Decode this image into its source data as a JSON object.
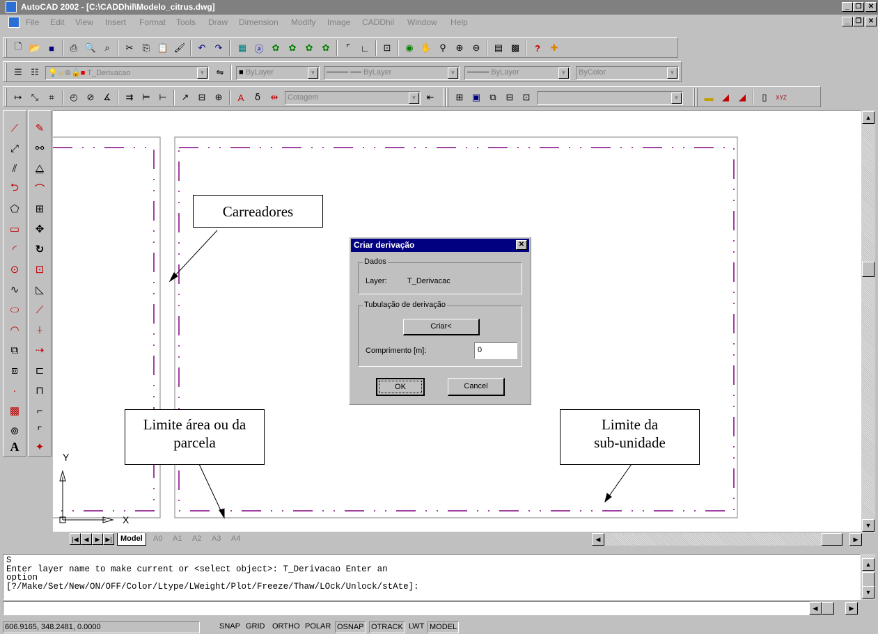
{
  "window": {
    "title": "AutoCAD 2002 - [C:\\CADDhil\\Modelo_citrus.dwg]",
    "min_label": "_",
    "restore_label": "❐",
    "close_label": "✕"
  },
  "menu": {
    "items": [
      "File",
      "Edit",
      "View",
      "Insert",
      "Format",
      "Tools",
      "Draw",
      "Dimension",
      "Modify",
      "Image",
      "CADDhil",
      "Window",
      "Help"
    ]
  },
  "layers": {
    "current_layer": "T_Derivacao",
    "color": "ByLayer",
    "linetype": "ByLayer",
    "lineweight": "ByLayer",
    "plotstyle": "ByColor"
  },
  "dim": {
    "style": "Cotagem"
  },
  "layout_tabs": [
    "Model",
    "A0",
    "A1",
    "A2",
    "A3",
    "A4"
  ],
  "command": {
    "lines": [
      "S",
      "Enter layer name to make current or <select object>: T_Derivacao Enter an",
      "option",
      "[?/Make/Set/New/ON/OFF/Color/Ltype/LWeight/Plot/Freeze/Thaw/LOck/Unlock/stAte]:"
    ],
    "input": ""
  },
  "status": {
    "coords": "606.9165, 348.2481, 0.0000",
    "toggles": [
      "SNAP",
      "GRID",
      "ORTHO",
      "POLAR",
      "OSNAP",
      "OTRACK",
      "LWT",
      "MODEL"
    ]
  },
  "callouts": {
    "carreadores": "Carreadores",
    "limite_area": "Limite área ou da parcela",
    "limite_sub": "Limite da sub-unidade"
  },
  "ucs": {
    "x": "X",
    "y": "Y"
  },
  "dialog": {
    "title": "Criar derivação",
    "group1": "Dados",
    "layer_label": "Layer:",
    "layer_value": "T_Derivacac",
    "group2": "Tubulação de derivação",
    "create_label": "Criar<",
    "length_label": "Comprimento [m]:",
    "length_value": "0",
    "ok_label": "OK",
    "cancel_label": "Cancel"
  },
  "colors": {
    "title_inactive": "#808080",
    "dialog_title": "#000080",
    "boundary": "#800080"
  }
}
